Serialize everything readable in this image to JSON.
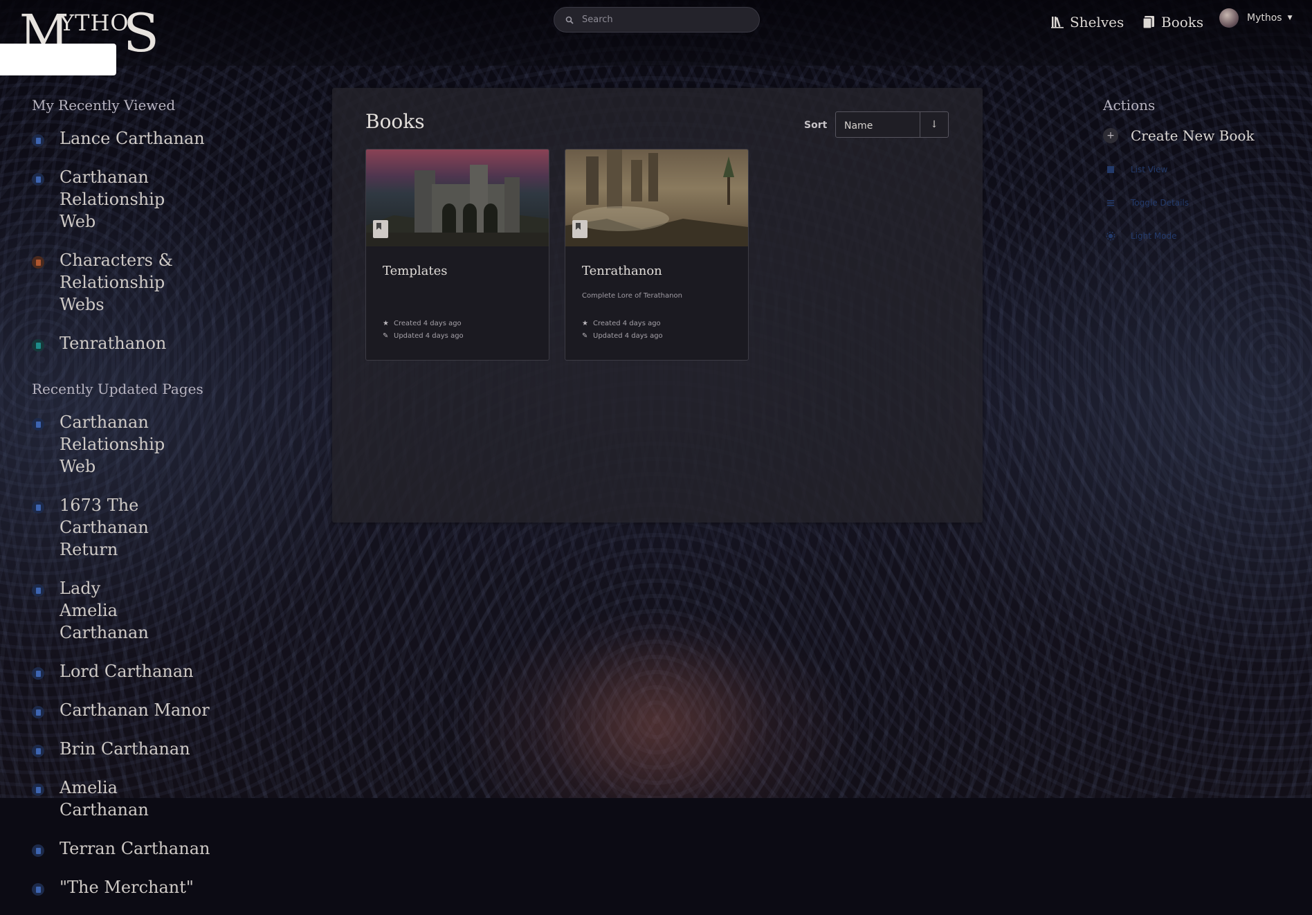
{
  "brand": {
    "logo_text": "MYTHOS"
  },
  "search": {
    "placeholder": "Search"
  },
  "nav": {
    "shelves": "Shelves",
    "books": "Books"
  },
  "user": {
    "name": "Mythos"
  },
  "recently_viewed": {
    "title": "My Recently Viewed",
    "items": [
      {
        "label": "Lance Carthanan",
        "type": "page"
      },
      {
        "label": "Carthanan Relationship Web",
        "type": "page"
      },
      {
        "label": "Characters & Relationship Webs",
        "type": "chapter"
      },
      {
        "label": "Tenrathanon",
        "type": "book"
      }
    ]
  },
  "recently_updated": {
    "title": "Recently Updated Pages",
    "items": [
      {
        "label": "Carthanan Relationship Web"
      },
      {
        "label": "1673 The Carthanan Return"
      },
      {
        "label": "Lady Amelia Carthanan"
      },
      {
        "label": "Lord Carthanan"
      },
      {
        "label": "Carthanan Manor"
      },
      {
        "label": "Brin Carthanan"
      },
      {
        "label": "Amelia Carthanan"
      },
      {
        "label": "Terran Carthanan"
      },
      {
        "label": "\"The Merchant\""
      }
    ]
  },
  "main": {
    "title": "Books",
    "sort_label": "Sort",
    "sort_value": "Name",
    "sort_direction": "↓",
    "books": [
      {
        "title": "Templates",
        "description": "",
        "created": "Created 4 days ago",
        "updated": "Updated 4 days ago"
      },
      {
        "title": "Tenrathanon",
        "description": "Complete Lore of Terathanon",
        "created": "Created 4 days ago",
        "updated": "Updated 4 days ago"
      }
    ]
  },
  "actions": {
    "title": "Actions",
    "create": "Create New Book",
    "list_view": "List View",
    "toggle_details": "Toggle Details",
    "light_mode": "Light Mode"
  },
  "colors": {
    "accent_page": "#3d64b0",
    "accent_chapter": "#b0562f",
    "accent_book": "#1e8c8a"
  }
}
